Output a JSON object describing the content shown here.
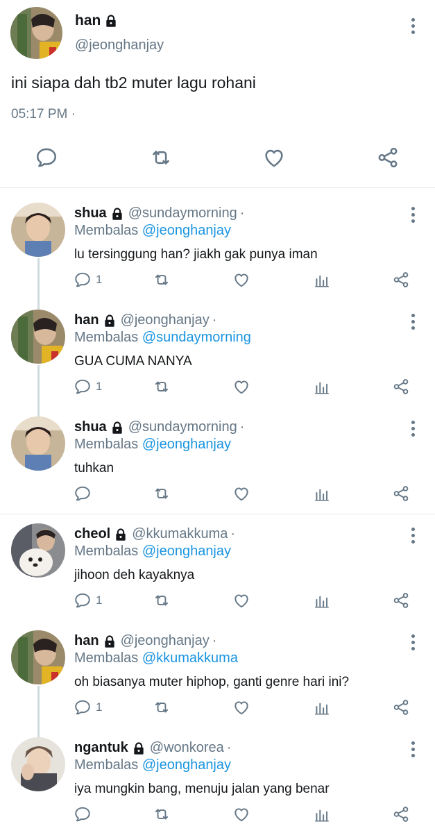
{
  "main_tweet": {
    "name": "han",
    "handle": "@jeonghanjay",
    "text": "ini siapa dah tb2 muter lagu rohani",
    "time": "05:17 PM ·"
  },
  "replies_label": "Membalas",
  "replies": [
    {
      "name": "shua",
      "handle": "@sundaymorning",
      "dot": "·",
      "mention": "@jeonghanjay",
      "text": "lu tersinggung han? jiakh gak punya iman",
      "reply_count": "1"
    },
    {
      "name": "han",
      "handle": "@jeonghanjay",
      "dot": "·",
      "mention": "@sundaymorning",
      "text": "GUA CUMA NANYA",
      "reply_count": "1"
    },
    {
      "name": "shua",
      "handle": "@sundaymorning",
      "dot": "·",
      "mention": "@jeonghanjay",
      "text": "tuhkan",
      "reply_count": ""
    },
    {
      "name": "cheol",
      "handle": "@kkumakkuma",
      "dot": "·",
      "mention": "@jeonghanjay",
      "text": "jihoon deh kayaknya",
      "reply_count": "1"
    },
    {
      "name": "han",
      "handle": "@jeonghanjay",
      "dot": "·",
      "mention": "@kkumakkuma",
      "text": "oh biasanya muter hiphop, ganti genre hari ini?",
      "reply_count": "1"
    },
    {
      "name": "ngantuk",
      "handle": "@wonkorea",
      "dot": "·",
      "mention": "@jeonghanjay",
      "text": "iya mungkin bang, menuju jalan yang benar",
      "reply_count": ""
    }
  ],
  "icons": {
    "reply": "reply-icon",
    "retweet": "retweet-icon",
    "like": "heart-icon",
    "analytics": "analytics-icon",
    "share": "share-icon",
    "lock": "lock-icon",
    "more": "more-vertical-icon"
  },
  "colors": {
    "accent": "#1b95e0",
    "secondary_text": "#657786",
    "primary_text": "#14171a",
    "divider": "#e1e8ed"
  }
}
